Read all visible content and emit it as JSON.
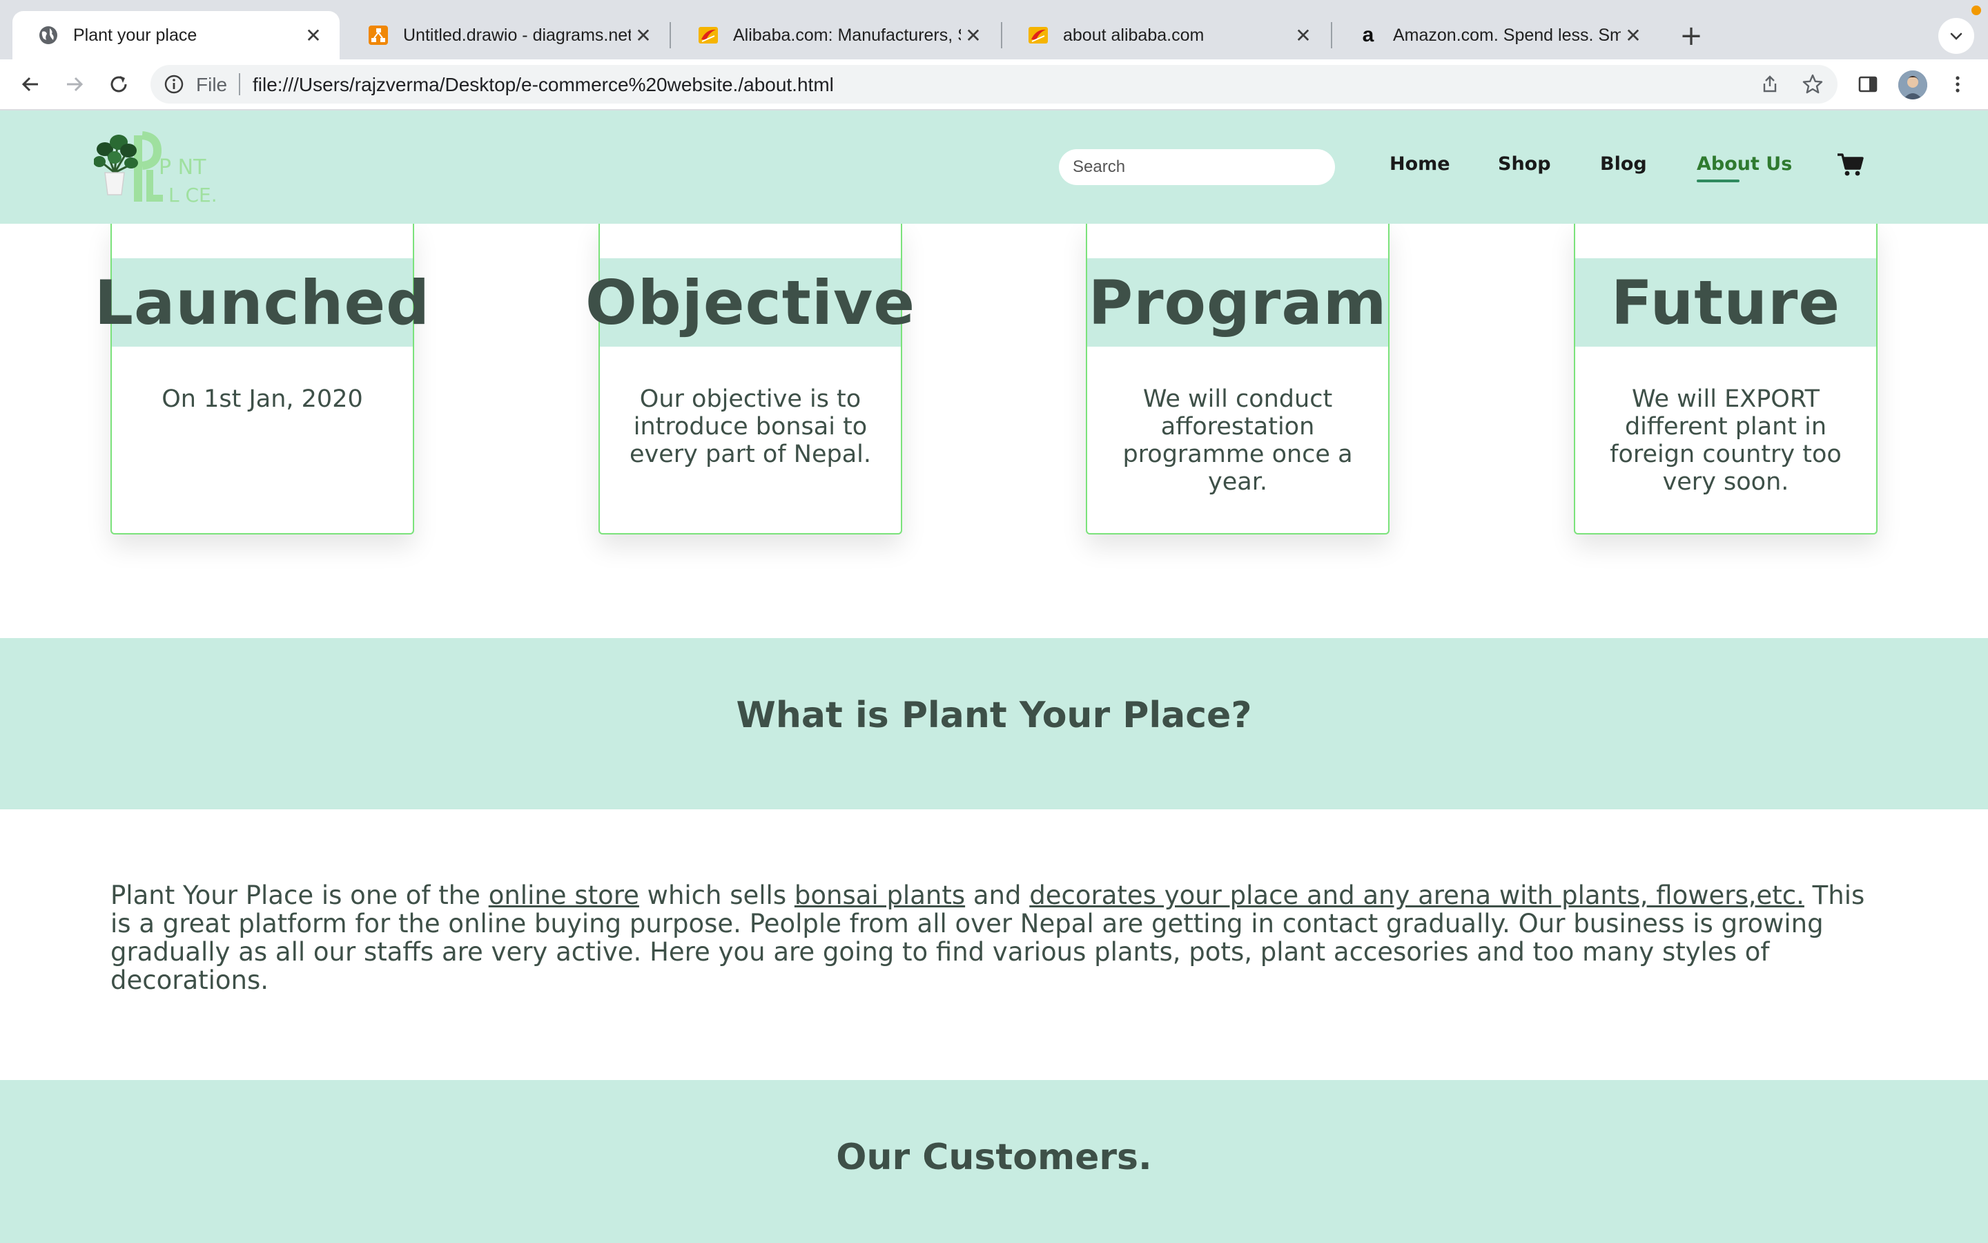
{
  "browser": {
    "tabs": [
      {
        "title": "Plant your place",
        "active": true,
        "icon": "globe-icon"
      },
      {
        "title": "Untitled.drawio - diagrams.net",
        "active": false,
        "icon": "drawio-icon"
      },
      {
        "title": "Alibaba.com: Manufacturers, S",
        "active": false,
        "icon": "alibaba-icon"
      },
      {
        "title": "about alibaba.com",
        "active": false,
        "icon": "alibaba-icon"
      },
      {
        "title": "Amazon.com. Spend less. Smil",
        "active": false,
        "icon": "amazon-icon"
      }
    ],
    "new_tab_label": "+",
    "close_glyph": "✕",
    "address_scheme": "File",
    "address_url": "file:///Users/rajzverma/Desktop/e-commerce%20website./about.html",
    "amazon_favicon_letter": "a"
  },
  "site": {
    "logo_text_top": "P NT",
    "logo_text_bottom": "L CE.",
    "search_placeholder": "Search",
    "nav": [
      {
        "label": "Home",
        "active": false
      },
      {
        "label": "Shop",
        "active": false
      },
      {
        "label": "Blog",
        "active": false
      },
      {
        "label": "About Us",
        "active": true
      }
    ],
    "cards": [
      {
        "title": "Launched",
        "body": "On 1st Jan, 2020"
      },
      {
        "title": "Objective",
        "body": "Our objective is to introduce bonsai to every part of Nepal."
      },
      {
        "title": "Program",
        "body": "We will conduct afforestation programme once a year."
      },
      {
        "title": "Future",
        "body": "We will EXPORT different plant in foreign country too very soon."
      }
    ],
    "what_heading": "What is Plant Your Place?",
    "about_paragraph": {
      "part1": "Plant Your Place is one of the ",
      "link1": "online store",
      "part2": " which sells ",
      "link2": "bonsai plants",
      "part3": " and ",
      "link3": "decorates your place and any arena with plants, flowers,etc.",
      "part4": " This is a great platform for the online buying purpose. Peolple from all over Nepal are getting in contact gradually. Our business is growing gradually as all our staffs are very active. Here you are going to find various plants, pots, plant accesories and too many styles of decorations."
    },
    "customers_heading": "Our Customers."
  },
  "colors": {
    "mint": "#c8ece1",
    "text": "#3e5048",
    "card_border": "#7be27b",
    "nav_active": "#2f7a2f"
  }
}
